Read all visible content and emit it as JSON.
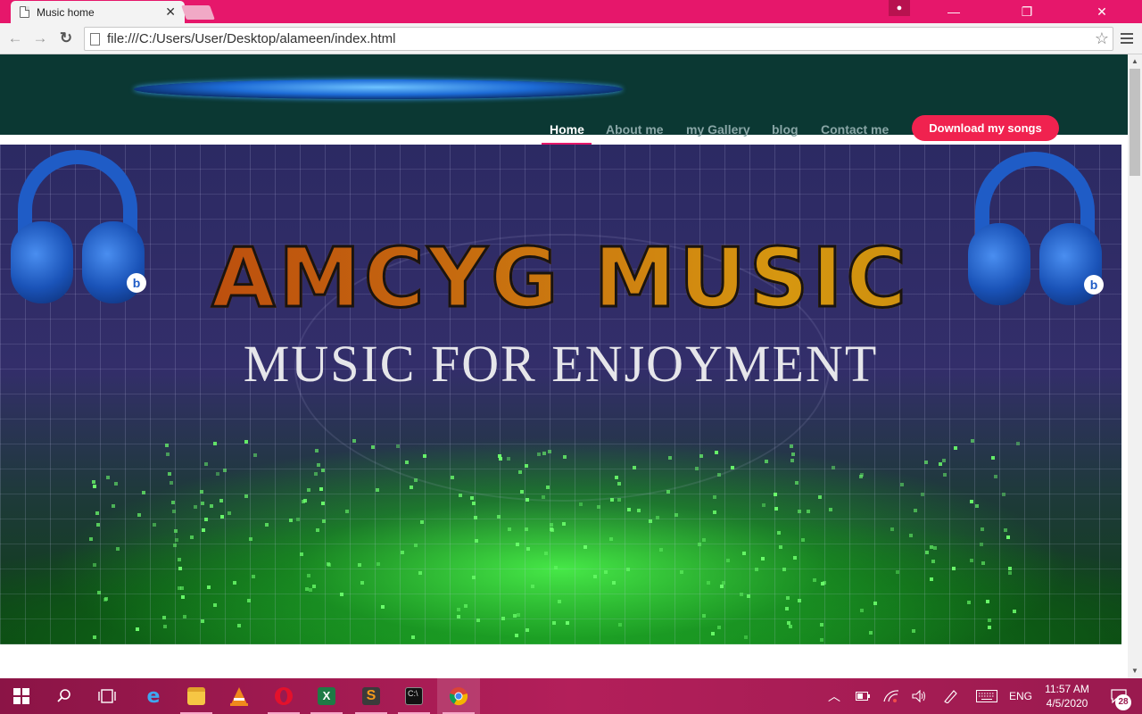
{
  "browser": {
    "tab_title": "Music home",
    "tab_close": "✕",
    "url": "file:///C:/Users/User/Desktop/alameen/index.html",
    "window_controls": {
      "minimize": "—",
      "restore": "❐",
      "close": "✕"
    },
    "nav_icons": {
      "back": "←",
      "forward": "→",
      "reload": "↻",
      "star": "☆"
    }
  },
  "site": {
    "nav": [
      {
        "label": "Home",
        "active": true
      },
      {
        "label": "About me"
      },
      {
        "label": "my Gallery"
      },
      {
        "label": "blog"
      },
      {
        "label": "Contact me"
      }
    ],
    "download_button": "Download my songs"
  },
  "hero": {
    "title": "AMCYG MUSIC",
    "subtitle": "MUSIC FOR ENJOYMENT",
    "headphone_logo": "b"
  },
  "taskbar": {
    "apps": [
      "start-icon",
      "search-icon",
      "task-view-icon",
      "edge-icon",
      "file-explorer-icon",
      "vlc-icon",
      "opera-icon",
      "excel-icon",
      "sublime-text-icon",
      "command-prompt-icon",
      "chrome-icon"
    ],
    "language": "ENG",
    "time": "11:57 AM",
    "date": "4/5/2020",
    "notification_count": "28"
  },
  "colors": {
    "titlebar": "#e6176b",
    "header_bg": "#0b3833",
    "accent": "#f0224f",
    "taskbar": "#9a1a4f"
  }
}
